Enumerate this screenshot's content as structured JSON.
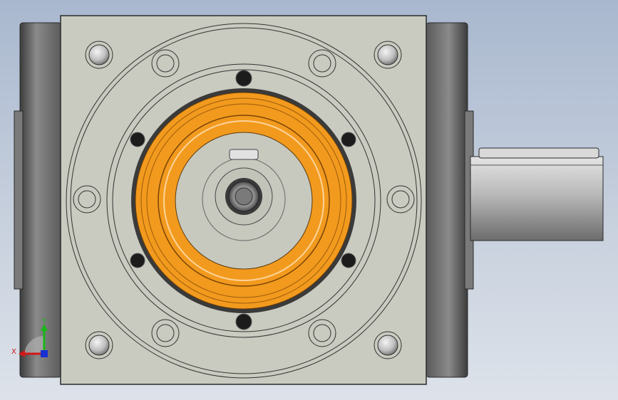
{
  "scene": {
    "view": "front",
    "colors": {
      "background_top": "#a9b8cf",
      "background_bottom": "#dde2ea",
      "housing": "#c9cbc0",
      "housing_edge": "#3a3a3a",
      "end_cap": "#6e6e6e",
      "bearing_orange": "#f29a1e",
      "shaft": "#b8b8b8"
    }
  },
  "triad": {
    "x_label": "X",
    "y_label": "Y",
    "x_color": "#d01818",
    "y_color": "#18b818",
    "z_color": "#1830d0"
  }
}
